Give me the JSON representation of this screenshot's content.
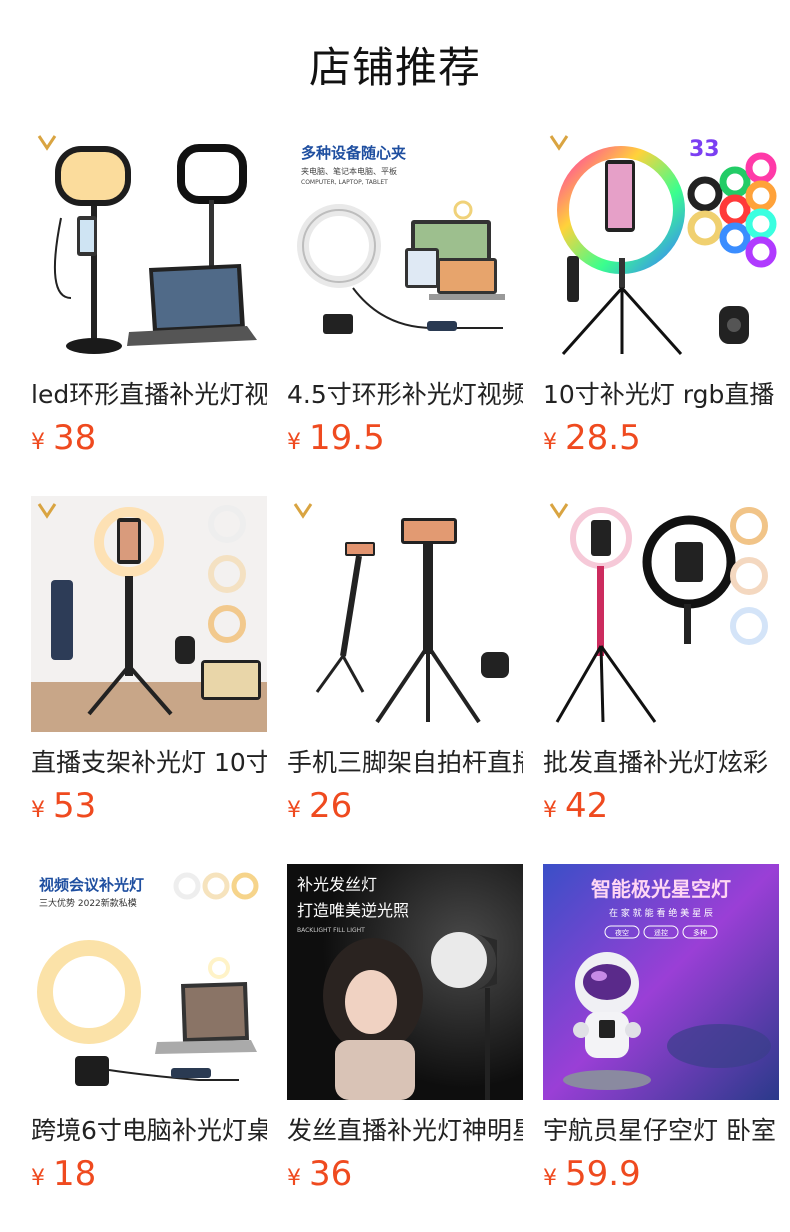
{
  "page": {
    "title": "店铺推荐",
    "colors": {
      "price": "#ef4a1f",
      "text": "#222222",
      "title": "#111111"
    }
  },
  "products": [
    {
      "name": "led环形直播补光灯视",
      "currency": "¥",
      "price": "38",
      "thumb": "desk-lamp-with-laptop",
      "img_texts": []
    },
    {
      "name": "4.5寸环形补光灯视频",
      "currency": "¥",
      "price": "19.5",
      "thumb": "clip-ring-light",
      "img_texts": [
        "多种设备随心夹",
        "夹电脑、笔记本电脑、平板",
        "COMPUTER, LAPTOP, TABLET"
      ]
    },
    {
      "name": "10寸补光灯 rgb直播",
      "currency": "¥",
      "price": "28.5",
      "thumb": "rgb-ring-light",
      "img_texts": [
        "33"
      ]
    },
    {
      "name": "直播支架补光灯 10寸",
      "currency": "¥",
      "price": "53",
      "thumb": "ring-light-tripod",
      "img_texts": []
    },
    {
      "name": "手机三脚架自拍杆直播",
      "currency": "¥",
      "price": "26",
      "thumb": "phone-tripod",
      "img_texts": []
    },
    {
      "name": "批发直播补光灯炫彩",
      "currency": "¥",
      "price": "42",
      "thumb": "ring-light-stand",
      "img_texts": []
    },
    {
      "name": "跨境6寸电脑补光灯桌",
      "currency": "¥",
      "price": "18",
      "thumb": "video-conference-light",
      "img_texts": [
        "视频会议补光灯",
        "三大优势  2022新款私模"
      ]
    },
    {
      "name": "发丝直播补光灯神明星",
      "currency": "¥",
      "price": "36",
      "thumb": "hair-light",
      "img_texts": [
        "补光发丝灯",
        "打造唯美逆光照",
        "BACKLIGHT FILL LIGHT"
      ]
    },
    {
      "name": "宇航员星仔空灯 卧室",
      "currency": "¥",
      "price": "59.9",
      "thumb": "astronaut-star-projector",
      "img_texts": [
        "智能极光星空灯",
        "在 家 就 能 看 绝 美 星 辰",
        "夜空",
        "遥控",
        "多种"
      ]
    }
  ]
}
